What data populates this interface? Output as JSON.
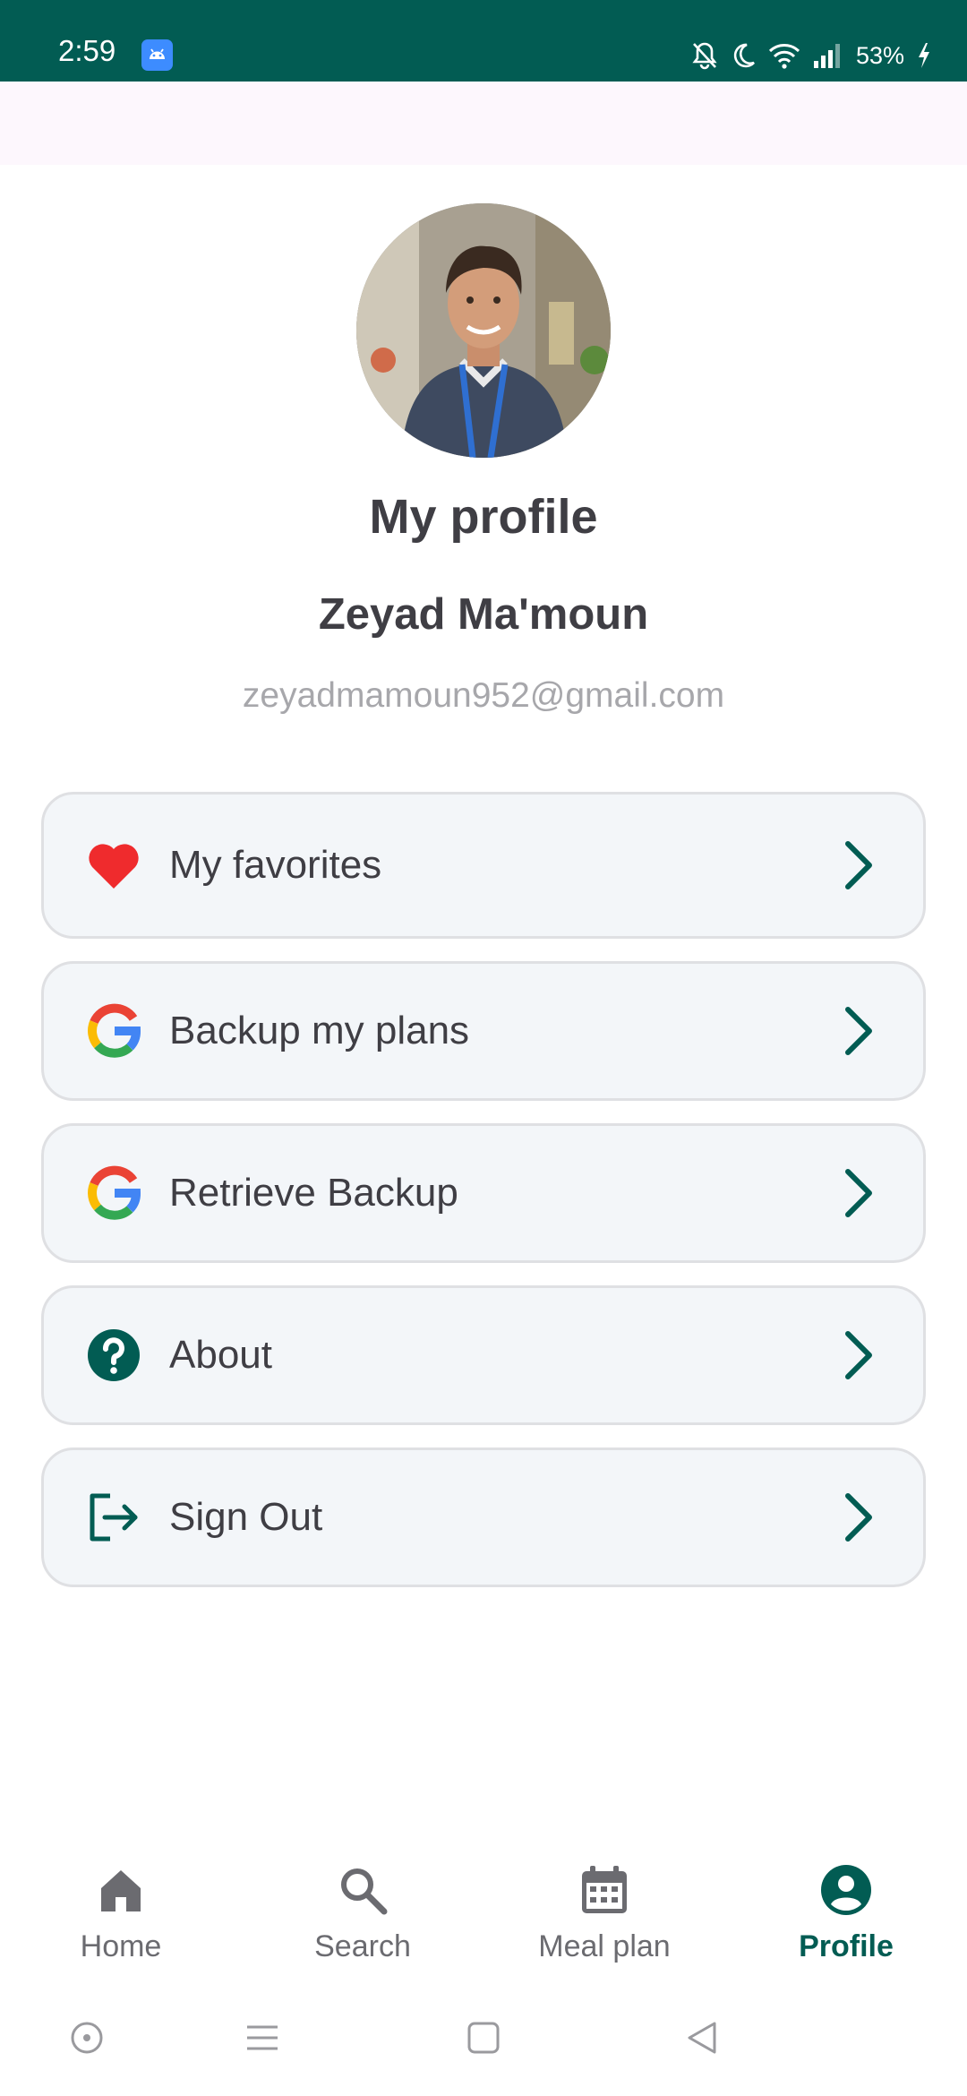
{
  "status_bar": {
    "time": "2:59",
    "battery": "53%"
  },
  "profile": {
    "title": "My profile",
    "name": "Zeyad Ma'moun",
    "email": "zeyadmamoun952@gmail.com"
  },
  "menu": [
    {
      "label": "My favorites",
      "icon": "heart-icon"
    },
    {
      "label": "Backup my plans",
      "icon": "google-icon"
    },
    {
      "label": "Retrieve Backup",
      "icon": "google-icon"
    },
    {
      "label": "About",
      "icon": "help-icon"
    },
    {
      "label": "Sign Out",
      "icon": "logout-icon"
    }
  ],
  "bottom_nav": [
    {
      "label": "Home",
      "icon": "home-icon",
      "active": false
    },
    {
      "label": "Search",
      "icon": "search-icon",
      "active": false
    },
    {
      "label": "Meal plan",
      "icon": "calendar-icon",
      "active": false
    },
    {
      "label": "Profile",
      "icon": "account-icon",
      "active": true
    }
  ],
  "colors": {
    "primary": "#025c53",
    "text": "#3f3e44",
    "muted": "#a7a7ab",
    "card_bg": "#f3f6f9",
    "heart": "#ef2b2d"
  }
}
